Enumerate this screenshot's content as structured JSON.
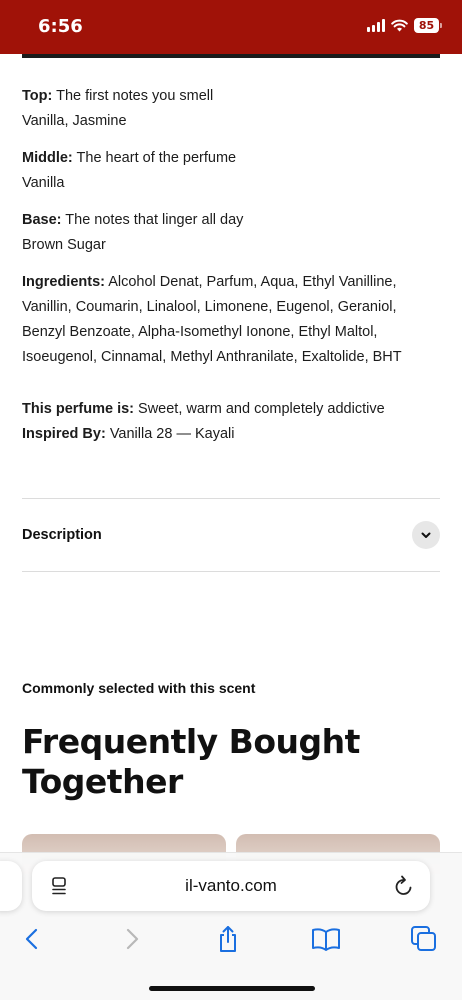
{
  "status_bar": {
    "time": "6:56",
    "battery": "85",
    "background": "#a01208"
  },
  "notes": {
    "top": {
      "label": "Top:",
      "description": "The first notes you smell",
      "value": "Vanilla, Jasmine"
    },
    "middle": {
      "label": "Middle:",
      "description": "The heart of the perfume",
      "value": "Vanilla"
    },
    "base": {
      "label": "Base:",
      "description": "The notes that linger all day",
      "value": "Brown Sugar"
    }
  },
  "ingredients": {
    "label": "Ingredients:",
    "text": "Alcohol Denat, Parfum, Aqua, Ethyl Vanilline, Vanillin, Coumarin, Linalool, Limonene, Eugenol, Geraniol, Benzyl Benzoate, Alpha-Isomethyl Ionone, Ethyl Maltol, Isoeugenol, Cinnamal, Methyl Anthranilate, Exaltolide, BHT"
  },
  "perfume_is": {
    "label": "This perfume is:",
    "value": "Sweet, warm and completely addictive"
  },
  "inspired_by": {
    "label": "Inspired By:",
    "value": "Vanilla 28 — Kayali"
  },
  "description": {
    "label": "Description",
    "icon": "chevron-down-icon"
  },
  "recommendations": {
    "subtitle": "Commonly selected with this scent",
    "title": "Frequently Bought Together"
  },
  "browser": {
    "url": "il-vanto.com",
    "icons": [
      "reader-icon",
      "reload-icon",
      "back-icon",
      "forward-icon",
      "share-icon",
      "bookmarks-icon",
      "tabs-icon"
    ],
    "accent": "#1a6fe0"
  }
}
